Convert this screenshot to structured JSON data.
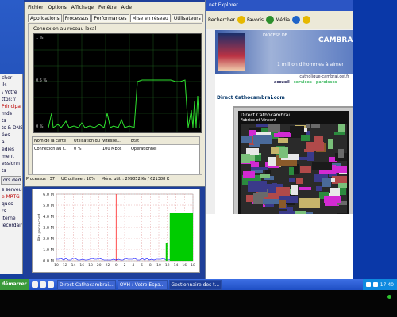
{
  "task_manager": {
    "menu": [
      "Fichier",
      "Options",
      "Affichage",
      "Fenêtre",
      "Aide"
    ],
    "tabs": [
      "Applications",
      "Processus",
      "Performances",
      "Mise en réseau",
      "Utilisateurs"
    ],
    "active_tab": "Mise en réseau",
    "graph_title": "Connexion au réseau local",
    "graph_ylabels": [
      "1 %",
      "0.5 %",
      "0 %"
    ],
    "table": {
      "headers": [
        "Nom de la carte",
        "Utilisation du r...",
        "Vitesse...",
        "État"
      ],
      "row": [
        "Connexion au r...",
        "0 %",
        "100 Mbps",
        "Opérationnel"
      ]
    },
    "status": {
      "processes": "Processus : 37",
      "cpu": "UC utilisée : 10%",
      "memory": "Mém. util. : 299852 Ko / 621388 K"
    }
  },
  "ie": {
    "title": "net Explorer",
    "toolbar": [
      "Rechercher",
      "Favoris",
      "Média"
    ],
    "page": {
      "banner_sub": "DIOCESE DE",
      "banner_title": "CAMBRAI",
      "slogan": "1 million d'hommes à aimer",
      "url": "catholique-cambrai.cef.fr",
      "nav": [
        "accueil",
        "services",
        "paroisses"
      ],
      "live_heading": "Direct Cathocambrai.com",
      "video_title": "Direct Cathocambrai",
      "video_subtitle": "Fabrice et Vincent"
    }
  },
  "left_window": {
    "lines": [
      "cher",
      "ils",
      "\\ Votre",
      "ttps://",
      "Principa",
      "mde",
      "ts",
      "ts & DNS",
      "ées",
      "a",
      "édiés",
      "ment",
      "essionn",
      "ts",
      "ors dédiés",
      "s serveur",
      "e MRTG",
      "ques",
      "rs",
      "iterne",
      "lecordaire"
    ]
  },
  "mrtg": {
    "ylabels": [
      "6.0 M",
      "5.0 M",
      "4.0 M",
      "3.0 M",
      "2.0 M",
      "1.0 M",
      "0.0 M"
    ],
    "xlabels": [
      "10",
      "12",
      "14",
      "16",
      "18",
      "20",
      "22",
      "0",
      "2",
      "4",
      "6",
      "8",
      "10",
      "12",
      "14",
      "16",
      "18"
    ],
    "ylabel": "Bits per second",
    "colors": {
      "in": "#00cc00",
      "out": "#0000ff",
      "now": "#ff0000"
    }
  },
  "taskbar": {
    "start": "démarrer",
    "tasks": [
      "Direct Cathocambrai...",
      "OVH : Votre Espa...",
      "Gestionnaire des t..."
    ],
    "active_task": 2,
    "clock": "17:40"
  }
}
